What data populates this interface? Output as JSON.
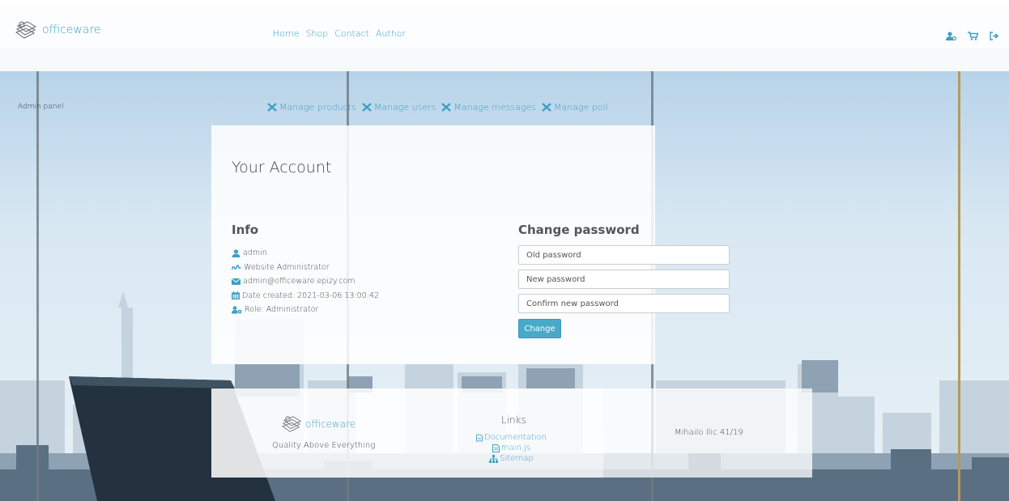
{
  "brand": {
    "name": "officeware",
    "tagline": "Quality Above Everything"
  },
  "nav": {
    "items": [
      "Home",
      "Shop",
      "Contact",
      "Author"
    ]
  },
  "top_icons": [
    "user-gear-icon",
    "cart-icon",
    "logout-icon"
  ],
  "admin": {
    "label": "Admin panel",
    "items": [
      "Manage products",
      "Manage users",
      "Manage messages",
      "Manage poll"
    ]
  },
  "account": {
    "title": "Your Account",
    "info_title": "Info",
    "username": "admin",
    "role_desc": "Website Administrator",
    "email": "admin@officeware.epizy.com",
    "date_created": "Date created: 2021-03-06 13:00:42",
    "role": "Role: Administrator"
  },
  "change_password": {
    "title": "Change password",
    "old_placeholder": "Old password",
    "new_placeholder": "New password",
    "confirm_placeholder": "Confirm new password",
    "button": "Change"
  },
  "footer": {
    "links_title": "Links",
    "links": [
      "Documentation",
      "main.js",
      "Sitemap"
    ],
    "author": "Mihailo Ilic 41/19"
  },
  "colors": {
    "accent": "#3f9fc4",
    "button": "#48a9c8"
  }
}
